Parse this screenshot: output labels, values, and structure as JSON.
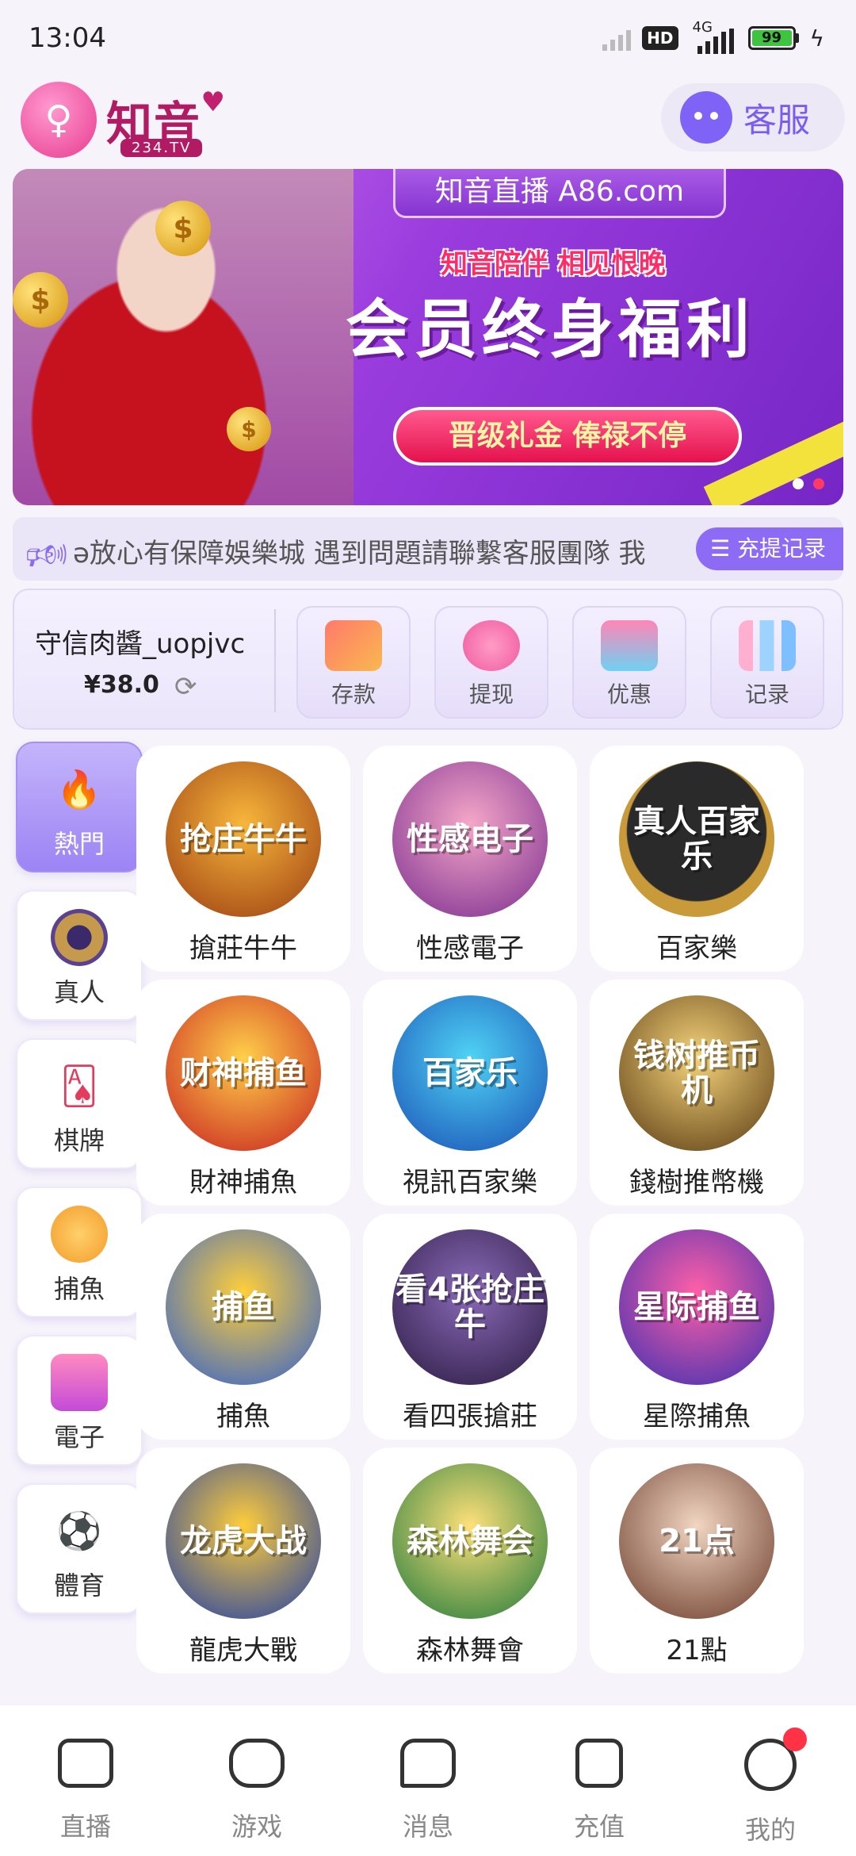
{
  "status_bar": {
    "time": "13:04",
    "hd": "HD",
    "network": "4G",
    "battery": "99"
  },
  "header": {
    "logo_main": "知音",
    "logo_sub": "234.TV",
    "service_label": "客服"
  },
  "banner": {
    "site": "知音直播  A86.com",
    "slogan": "知音陪伴 相见恨晚",
    "headline": "会员终身福利",
    "cta": "晋级礼金 俸禄不停"
  },
  "marquee": {
    "text": "ǝ放心有保障娛樂城  遇到問題請聯繫客服團隊  我",
    "record_button": "充提记录"
  },
  "account": {
    "username": "守信肉醬_uopjvc",
    "balance": "¥38.0",
    "actions": [
      {
        "label": "存款",
        "icon": "deposit-card-icon"
      },
      {
        "label": "提现",
        "icon": "money-bag-icon"
      },
      {
        "label": "优惠",
        "icon": "gift-icon"
      },
      {
        "label": "记录",
        "icon": "bar-chart-icon"
      }
    ]
  },
  "categories": [
    {
      "label": "熱門",
      "icon": "fire-icon",
      "active": true
    },
    {
      "label": "真人",
      "icon": "chip-icon",
      "active": false
    },
    {
      "label": "棋牌",
      "icon": "playing-card-icon",
      "active": false
    },
    {
      "label": "捕魚",
      "icon": "fish-icon",
      "active": false
    },
    {
      "label": "電子",
      "icon": "slot-machine-icon",
      "active": false
    },
    {
      "label": "體育",
      "icon": "soccer-ball-icon",
      "active": false
    }
  ],
  "games": [
    {
      "name": "搶莊牛牛",
      "art": "抢庄牛牛"
    },
    {
      "name": "性感電子",
      "art": "性感电子"
    },
    {
      "name": "百家樂",
      "art": "真人百家乐"
    },
    {
      "name": "財神捕魚",
      "art": "财神捕鱼"
    },
    {
      "name": "視訊百家樂",
      "art": "百家乐"
    },
    {
      "name": "錢樹推幣機",
      "art": "钱树推币机"
    },
    {
      "name": "捕魚",
      "art": "捕鱼"
    },
    {
      "name": "看四張搶莊",
      "art": "看4张抢庄牛"
    },
    {
      "name": "星際捕魚",
      "art": "星际捕鱼"
    },
    {
      "name": "龍虎大戰",
      "art": "龙虎大战"
    },
    {
      "name": "森林舞會",
      "art": "森林舞会"
    },
    {
      "name": "21點",
      "art": "21点"
    }
  ],
  "bottom_nav": [
    {
      "label": "直播",
      "icon": "video-camera-icon"
    },
    {
      "label": "游戏",
      "icon": "gamepad-icon"
    },
    {
      "label": "消息",
      "icon": "chat-heart-icon"
    },
    {
      "label": "充值",
      "icon": "wallet-icon"
    },
    {
      "label": "我的",
      "icon": "profile-face-icon"
    }
  ],
  "colors": {
    "accent": "#8d6bf5",
    "brand": "#b01b63",
    "badge": "#ff3246"
  }
}
